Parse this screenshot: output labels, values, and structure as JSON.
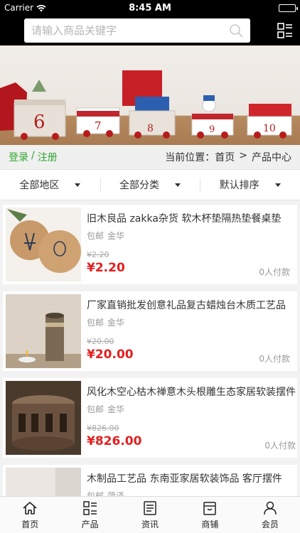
{
  "status_bar": {
    "carrier": "Carrier",
    "time": "8:45 AM"
  },
  "search": {
    "placeholder": "请输入商品关键字"
  },
  "location_bar": {
    "login": "登录",
    "separator": "/",
    "register": "注册",
    "current_label": "当前位置：",
    "home": "首页",
    "arrow": ">",
    "current": "产品中心"
  },
  "filters": [
    {
      "label": "全部地区"
    },
    {
      "label": "全部分类"
    },
    {
      "label": "默认排序"
    }
  ],
  "products": [
    {
      "title": "旧木良品 zakka杂货 软木杯垫隔热垫餐桌垫",
      "shipping": "包邮",
      "location": "金华",
      "old_price": "¥2.20",
      "price": "¥2.20",
      "sold": "0人付款"
    },
    {
      "title": "厂家直销批发创意礼品复古蜡烛台木质工艺品",
      "shipping": "包邮",
      "location": "金华",
      "old_price": "¥20.00",
      "price": "¥20.00",
      "sold": "0人付款"
    },
    {
      "title": "风化木空心枯木禅意木头根雕生态家居软装摆件",
      "shipping": "包邮",
      "location": "金华",
      "old_price": "¥826.00",
      "price": "¥826.00",
      "sold": "0人付款"
    },
    {
      "title": "木制品工艺品 东南亚家居软装饰品 客厅摆件",
      "shipping": "包邮",
      "location": "菏泽",
      "old_price": "",
      "price": "",
      "sold": ""
    }
  ],
  "tabs": [
    {
      "label": "首页",
      "icon": "home-icon"
    },
    {
      "label": "产品",
      "icon": "grid-list-icon"
    },
    {
      "label": "资讯",
      "icon": "news-icon"
    },
    {
      "label": "商铺",
      "icon": "store-icon"
    },
    {
      "label": "会员",
      "icon": "user-icon"
    }
  ],
  "banner": {
    "numbers": [
      "6",
      "7",
      "8",
      "9",
      "10"
    ]
  }
}
